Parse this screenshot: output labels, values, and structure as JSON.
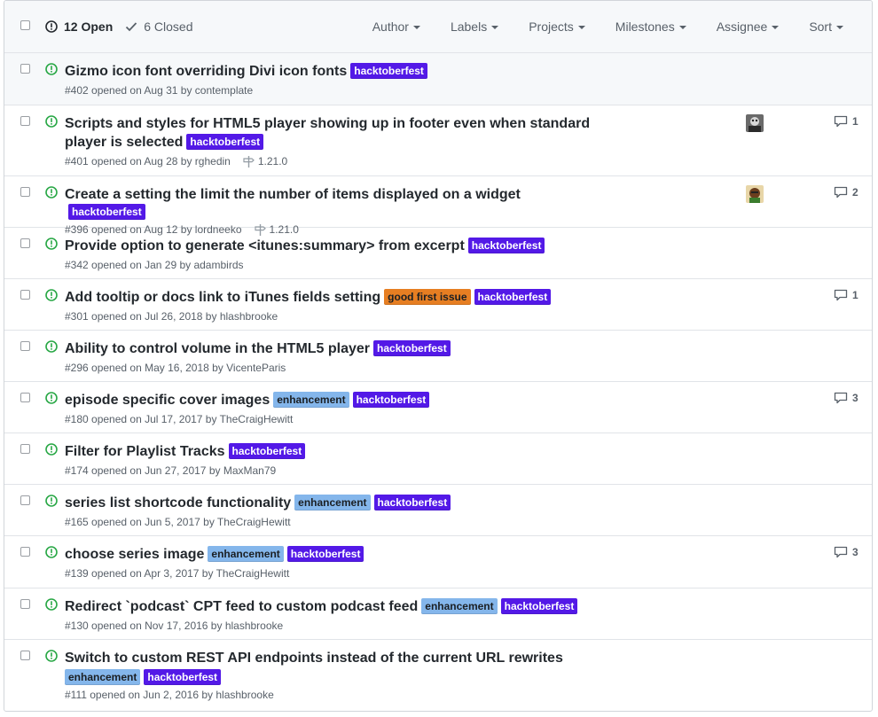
{
  "header": {
    "open_label": "12 Open",
    "closed_label": "6 Closed",
    "filters": [
      "Author",
      "Labels",
      "Projects",
      "Milestones",
      "Assignee",
      "Sort"
    ]
  },
  "colors": {
    "hacktoberfest": "#5319e7",
    "enhancement": "#84b6eb",
    "good_first_issue": "#e67e22",
    "open_icon": "#28a745"
  },
  "issues": [
    {
      "title": "Gizmo icon font overriding Divi icon fonts",
      "labels": [
        "hacktoberfest"
      ],
      "meta": "#402 opened on Aug 31 by contemplate"
    },
    {
      "title": "Scripts and styles for HTML5 player showing up in footer even when standard player is selected",
      "labels": [
        "hacktoberfest"
      ],
      "meta": "#401 opened on Aug 28 by rghedin",
      "milestone": "1.21.0",
      "comments": "1",
      "avatar": "avatar-1"
    },
    {
      "title": "Create a setting the limit the number of items displayed on a widget",
      "labels": [
        "hacktoberfest"
      ],
      "meta": "#396 opened on Aug 12 by lordneeko",
      "milestone": "1.21.0",
      "comments": "2",
      "avatar": "avatar-2"
    },
    {
      "title": "Provide option to generate <itunes:summary> from excerpt",
      "labels": [
        "hacktoberfest"
      ],
      "meta": "#342 opened on Jan 29 by adambirds"
    },
    {
      "title": "Add tooltip or docs link to iTunes fields setting",
      "labels": [
        "good first issue",
        "hacktoberfest"
      ],
      "meta": "#301 opened on Jul 26, 2018 by hlashbrooke",
      "comments": "1"
    },
    {
      "title": "Ability to control volume in the HTML5 player",
      "labels": [
        "hacktoberfest"
      ],
      "meta": "#296 opened on May 16, 2018 by VicenteParis"
    },
    {
      "title": "episode specific cover images",
      "labels": [
        "enhancement",
        "hacktoberfest"
      ],
      "meta": "#180 opened on Jul 17, 2017 by TheCraigHewitt",
      "comments": "3"
    },
    {
      "title": "Filter for Playlist Tracks",
      "labels": [
        "hacktoberfest"
      ],
      "meta": "#174 opened on Jun 27, 2017 by MaxMan79"
    },
    {
      "title": "series list shortcode functionality",
      "labels": [
        "enhancement",
        "hacktoberfest"
      ],
      "meta": "#165 opened on Jun 5, 2017 by TheCraigHewitt"
    },
    {
      "title": "choose series image",
      "labels": [
        "enhancement",
        "hacktoberfest"
      ],
      "meta": "#139 opened on Apr 3, 2017 by TheCraigHewitt",
      "comments": "3"
    },
    {
      "title": "Redirect `podcast` CPT feed to custom podcast feed",
      "labels": [
        "enhancement",
        "hacktoberfest"
      ],
      "meta": "#130 opened on Nov 17, 2016 by hlashbrooke"
    },
    {
      "title": "Switch to custom REST API endpoints instead of the current URL rewrites",
      "labels": [
        "enhancement",
        "hacktoberfest"
      ],
      "meta": "#111 opened on Jun 2, 2016 by hlashbrooke",
      "labels_on_new_line": true
    }
  ]
}
